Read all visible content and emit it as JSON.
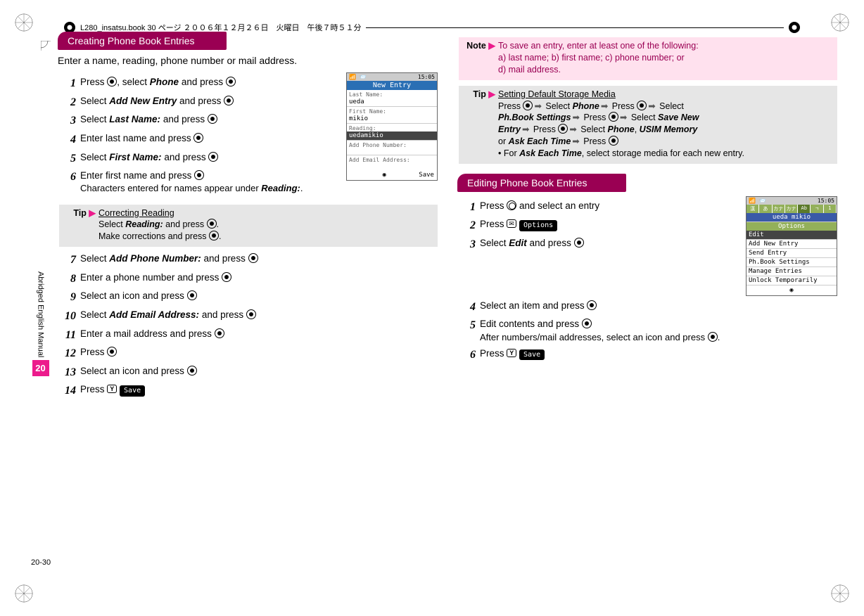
{
  "book_header": {
    "filename": "L280_insatsu.book 30 ページ ２００６年１２月２６日　火曜日　午後７時５１分"
  },
  "side": {
    "label": "Abridged English Manual",
    "chapter": "20",
    "page_number": "20-30"
  },
  "left": {
    "section_title": "Creating Phone Book Entries",
    "intro": "Enter a name, reading, phone number or mail address.",
    "steps": {
      "s1a": "Press ",
      "s1b": ", select ",
      "s1c": "Phone",
      "s1d": " and press ",
      "s2a": "Select ",
      "s2b": "Add New Entry",
      "s2c": " and press ",
      "s3a": "Select ",
      "s3b": "Last Name:",
      "s3c": " and press ",
      "s4a": "Enter last name and press ",
      "s5a": "Select ",
      "s5b": "First Name:",
      "s5c": " and press ",
      "s6a": "Enter first name and press ",
      "s6b": "Characters entered for names appear under ",
      "s6c": "Reading:",
      "s6d": ".",
      "tip_title": "Correcting Reading",
      "tip_l1a": "Select ",
      "tip_l1b": "Reading:",
      "tip_l1c": " and press ",
      "tip_l2a": "Make corrections and press ",
      "s7a": "Select ",
      "s7b": "Add Phone Number:",
      "s7c": " and press ",
      "s8a": "Enter a phone number and press ",
      "s9a": "Select an icon and press ",
      "s10a": "Select ",
      "s10b": "Add Email Address:",
      "s10c": " and press ",
      "s11a": "Enter a mail address and press ",
      "s12a": "Press ",
      "s13a": "Select an icon and press ",
      "s14a": "Press ",
      "save_label": "Save"
    },
    "nums": {
      "n1": "1",
      "n2": "2",
      "n3": "3",
      "n4": "4",
      "n5": "5",
      "n6": "6",
      "n7": "7",
      "n8": "8",
      "n9": "9",
      "n10": "10",
      "n11": "11",
      "n12": "12",
      "n13": "13",
      "n14": "14"
    },
    "phone_shot1": {
      "time": "15:05",
      "title": "New Entry",
      "last_lbl": "Last Name:",
      "last": "ueda",
      "first_lbl": "First Name:",
      "first": "mikio",
      "reading_lbl": "Reading:",
      "reading": "uedamikio",
      "phone_lbl": "Add Phone Number:",
      "email_lbl": "Add Email Address:",
      "soft_right": "Save"
    },
    "tip_tag": "Tip",
    "arrow": "▶"
  },
  "right": {
    "note_tag": "Note",
    "note_body_a": "To save an entry, enter at least one of the following:",
    "note_body_b": "a) last name; b) first name; c) phone number; or",
    "note_body_c": "d) mail address.",
    "tip_tag": "Tip",
    "tip2_title": "Setting Default Storage Media",
    "tip2_a": "Press ",
    "tip2_b": " Select ",
    "tip2_c": "Phone",
    "tip2_d": " Press ",
    "tip2_e": " Select",
    "tip2_f": "Ph.Book Settings",
    "tip2_g": " Press ",
    "tip2_h": " Select ",
    "tip2_i": "Save New",
    "tip2_j": "Entry",
    "tip2_k": " Press ",
    "tip2_l": " Select ",
    "tip2_m": "Phone",
    "tip2_n": ", ",
    "tip2_o": "USIM Memory",
    "tip2_p": "or ",
    "tip2_q": "Ask Each Time",
    "tip2_r": " Press ",
    "tip2_bullet_a": "For ",
    "tip2_bullet_b": "Ask Each Time",
    "tip2_bullet_c": ", select storage media for each new entry.",
    "section_title": "Editing Phone Book Entries",
    "steps": {
      "s1a": "Press ",
      "s1b": " and select an entry",
      "s2a": "Press ",
      "s2b": "Options",
      "s3a": "Select ",
      "s3b": "Edit",
      "s3c": " and press ",
      "s4a": "Select an item and press ",
      "s5a": "Edit contents and press ",
      "s5b": "After numbers/mail addresses, select an icon and press ",
      "s6a": "Press ",
      "save_label": "Save"
    },
    "nums": {
      "n1": "1",
      "n2": "2",
      "n3": "3",
      "n4": "4",
      "n5": "5",
      "n6": "6"
    },
    "phone_shot2": {
      "time": "15:05",
      "tabs": [
        "漢",
        "あ",
        "カナ",
        "カナ",
        "Ab",
        "ㄱ",
        "1"
      ],
      "name": "ueda mikio",
      "options": "Options",
      "edit": "Edit",
      "menu1": "Add New Entry",
      "menu2": "Send Entry",
      "menu3": "Ph.Book Settings",
      "menu4": "Manage Entries",
      "menu5": "Unlock Temporarily"
    }
  }
}
